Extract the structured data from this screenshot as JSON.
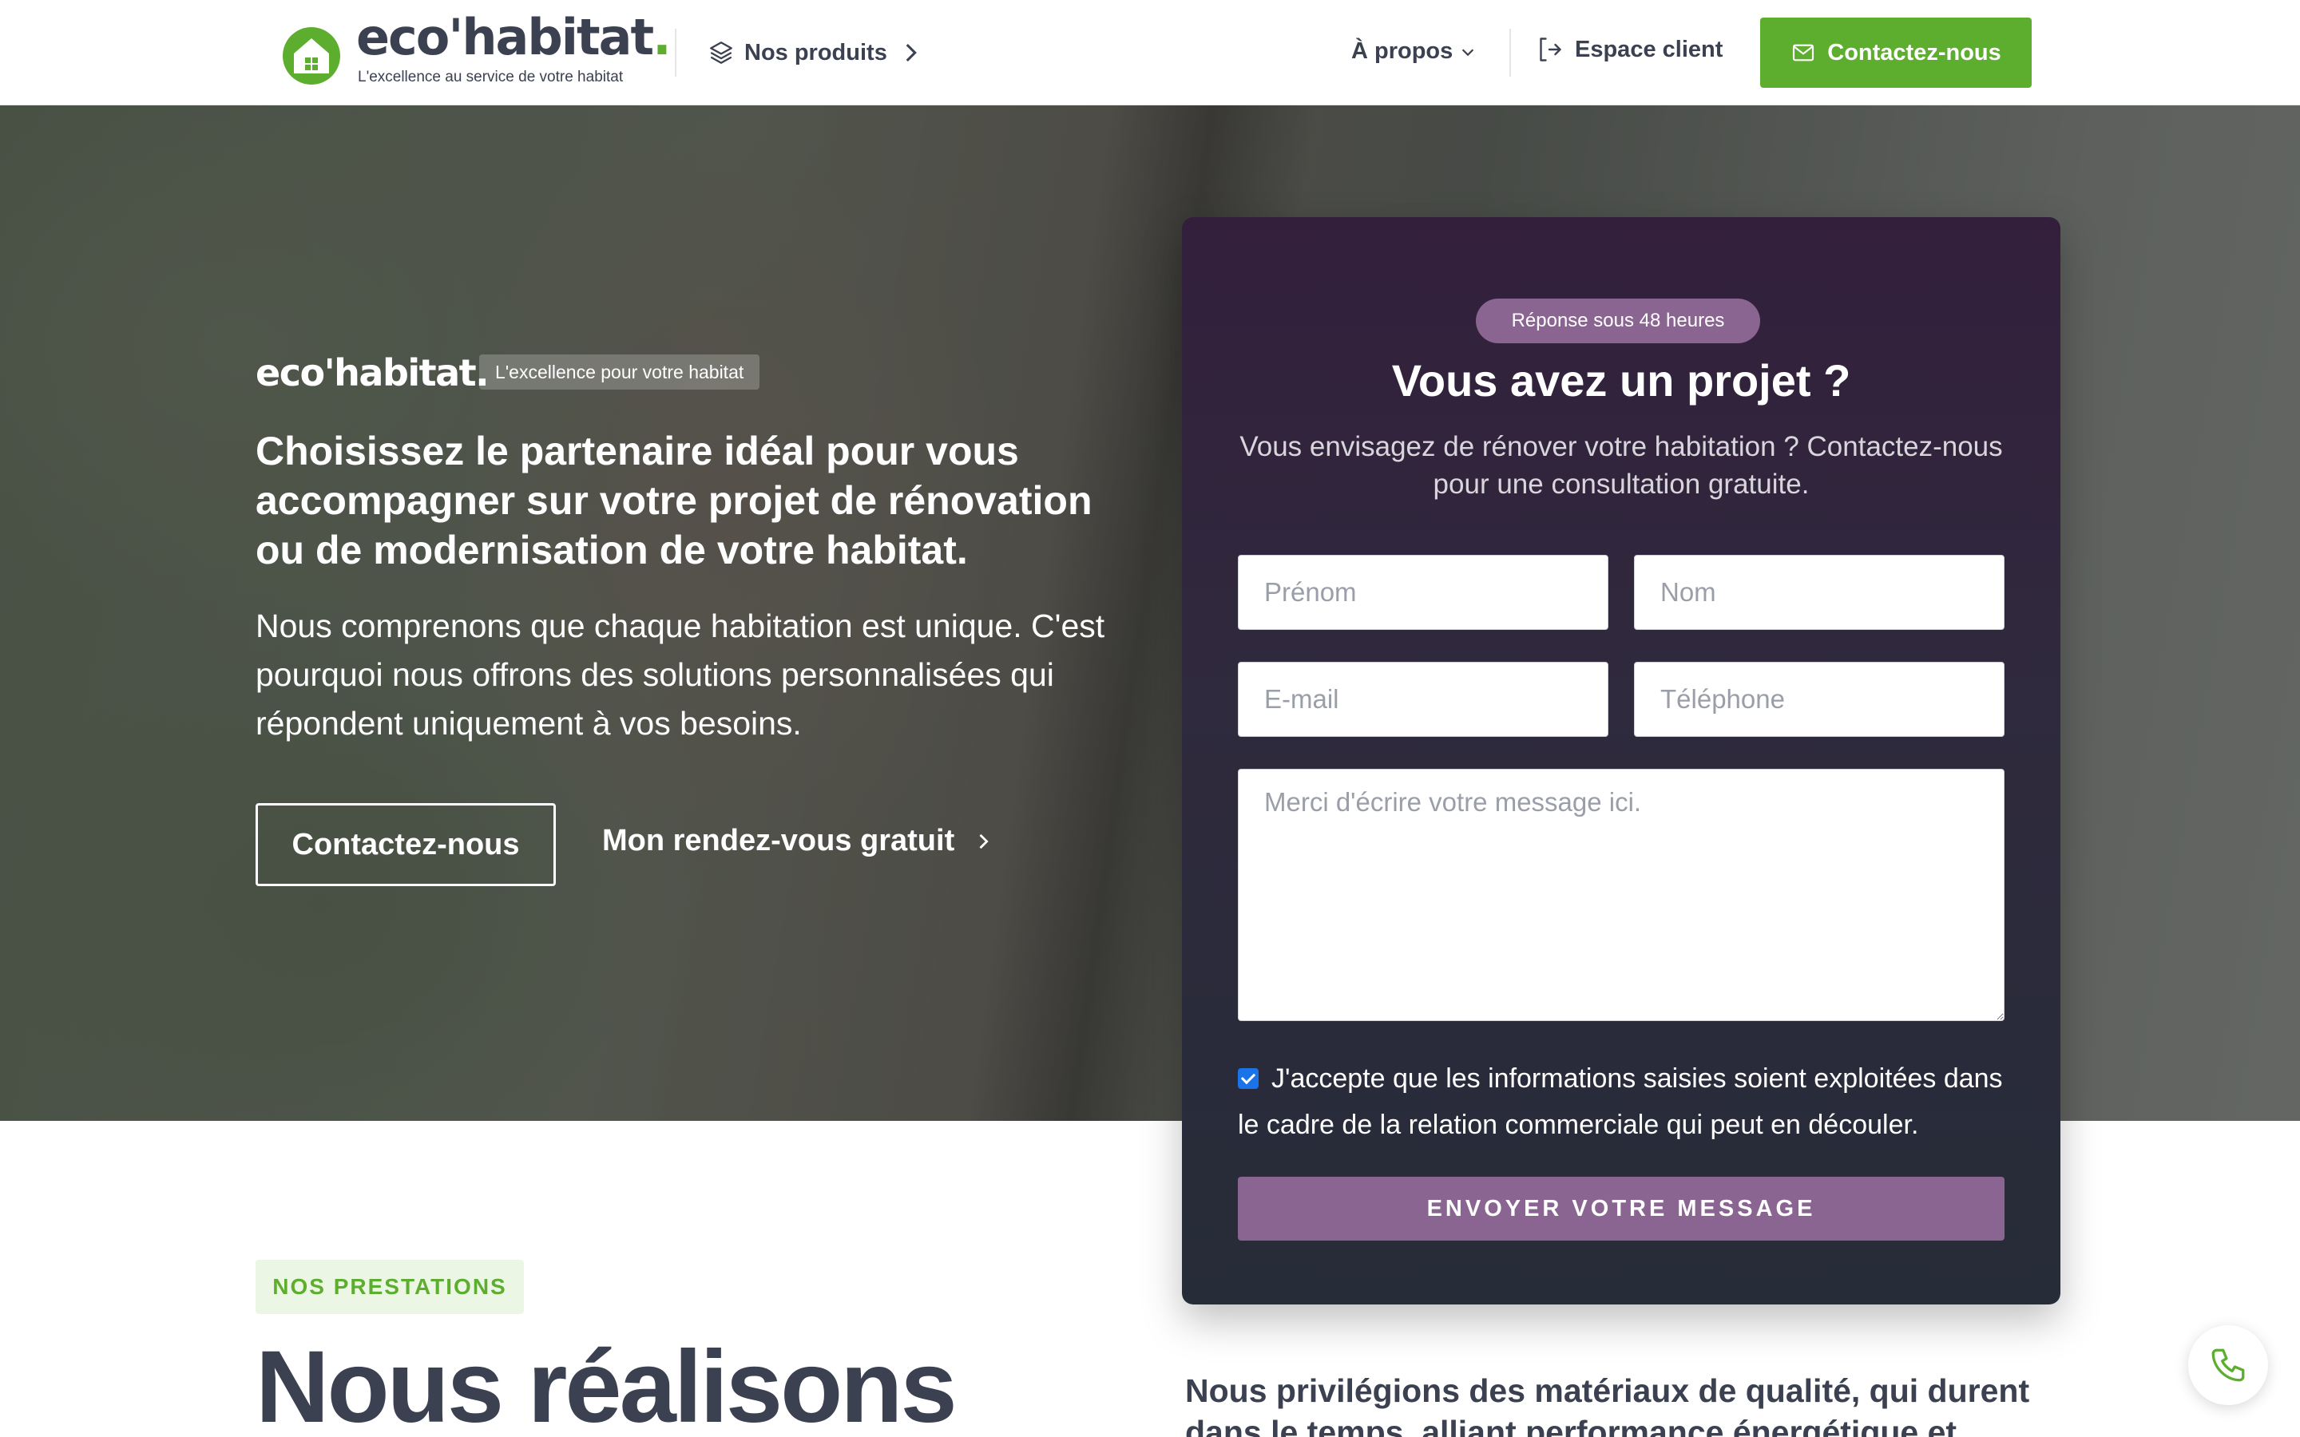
{
  "header": {
    "logo_text": "eco'habitat",
    "logo_dot": ".",
    "logo_tagline": "L'excellence au service de votre habitat",
    "products_label": "Nos produits",
    "about_label": "À propos",
    "client_label": "Espace client",
    "contact_label": "Contactez-nous"
  },
  "hero": {
    "brand": "eco'habitat.",
    "badge": "L'excellence pour votre habitat",
    "headline": "Choisissez le partenaire idéal pour vous accompagner sur votre projet de rénovation ou de modernisation de votre habitat.",
    "paragraph": "Nous comprenons que chaque habitation est unique. C'est pourquoi nous offrons des solutions personnalisées qui répondent uniquement à vos besoins.",
    "cta_primary": "Contactez-nous",
    "cta_secondary": "Mon rendez-vous gratuit"
  },
  "form": {
    "pill": "Réponse sous 48 heures",
    "title": "Vous avez un projet ?",
    "subtitle": "Vous envisagez de rénover votre habitation ? Contactez-nous pour une consultation gratuite.",
    "firstname_placeholder": "Prénom",
    "lastname_placeholder": "Nom",
    "email_placeholder": "E-mail",
    "phone_placeholder": "Téléphone",
    "message_placeholder": "Merci d'écrire votre message ici.",
    "consent": "J'accepte que les informations saisies soient exploitées dans le cadre de la relation commerciale qui peut en découler.",
    "consent_checked": true,
    "submit": "ENVOYER VOTRE MESSAGE"
  },
  "prestations": {
    "tag": "NOS PRESTATIONS",
    "title": "Nous réalisons",
    "text": "Nous privilégions des matériaux de qualité, qui durent dans le temps, alliant performance énergétique et"
  },
  "colors": {
    "brand_green": "#5dae2f",
    "brand_purple": "#8a6591",
    "text_dark": "#3b4150"
  },
  "icons": {
    "logo": "house-logo-icon",
    "products": "layers-icon",
    "about": "chevron-down-icon",
    "client": "sign-in-icon",
    "contact": "mail-icon",
    "secondary_cta": "chevron-right-icon",
    "floating": "phone-icon"
  }
}
